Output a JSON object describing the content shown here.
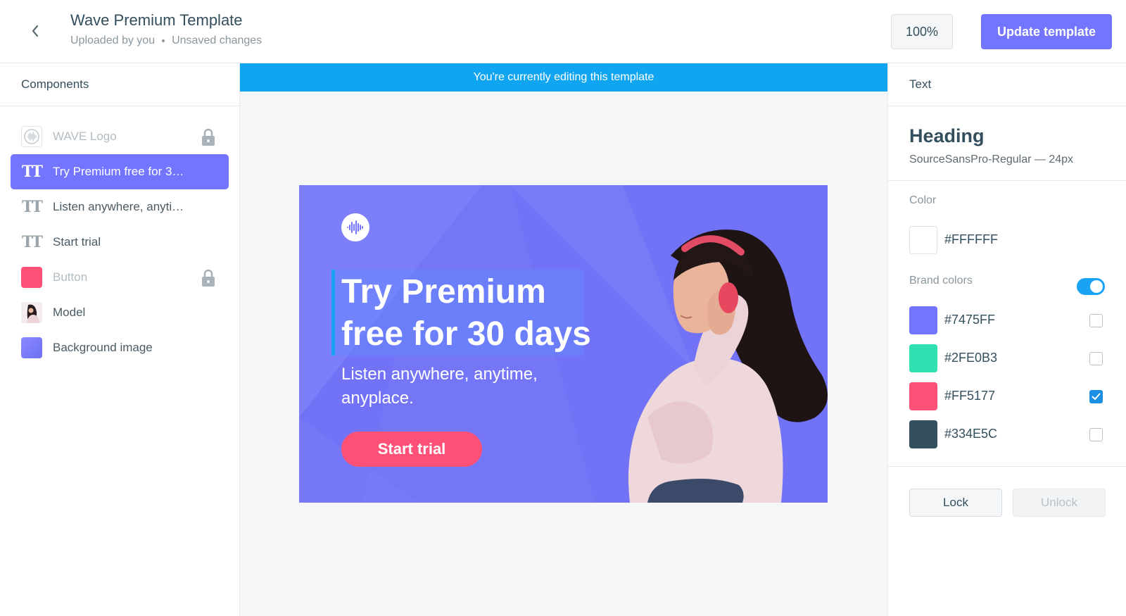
{
  "header": {
    "title": "Wave Premium Template",
    "uploaded_by": "Uploaded by you",
    "status": "Unsaved changes",
    "zoom": "100%",
    "update_label": "Update template"
  },
  "sidebar": {
    "heading": "Components",
    "items": [
      {
        "label": "WAVE Logo",
        "icon": "wave-logo-thumb",
        "locked": true
      },
      {
        "label": "Try Premium free for 30…",
        "icon": "text-icon",
        "selected": true
      },
      {
        "label": "Listen anywhere, anyti…",
        "icon": "text-icon"
      },
      {
        "label": "Start trial",
        "icon": "text-icon"
      },
      {
        "label": "Button",
        "icon": "pink-swatch",
        "locked": true
      },
      {
        "label": "Model",
        "icon": "model-thumb"
      },
      {
        "label": "Background image",
        "icon": "purple-swatch"
      }
    ]
  },
  "canvas": {
    "editing_banner": "You're currently editing this template",
    "heading_line1": "Try Premium",
    "heading_line2": "free for 30 days",
    "subtext_line1": "Listen anywhere, anytime,",
    "subtext_line2": "anyplace.",
    "cta": "Start trial"
  },
  "panel": {
    "section": "Text",
    "element_title": "Heading",
    "font_info": "SourceSansPro-Regular — 24px",
    "color_label": "Color",
    "current_color": "#FFFFFF",
    "brand_colors_label": "Brand colors",
    "brand_colors_enabled": true,
    "brand_colors": [
      {
        "hex": "#7475FF",
        "checked": false
      },
      {
        "hex": "#2FE0B3",
        "checked": false
      },
      {
        "hex": "#FF5177",
        "checked": true
      },
      {
        "hex": "#334E5C",
        "checked": false
      }
    ],
    "lock_label": "Lock",
    "unlock_label": "Unlock"
  },
  "colors": {
    "accent": "#7475FF",
    "info_banner": "#0fa5f0",
    "cta": "#FF5177"
  }
}
